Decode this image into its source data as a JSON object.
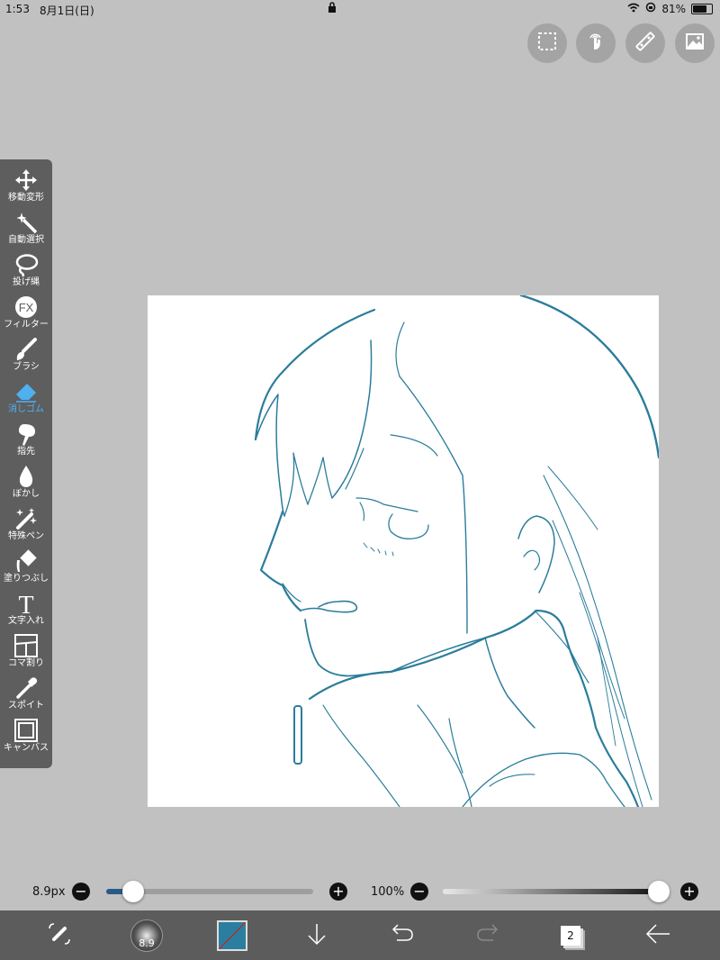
{
  "status_bar": {
    "time": "1:53",
    "date": "8月1日(日)",
    "battery": "81%",
    "battery_level": 0.81
  },
  "top_actions": {
    "icons": [
      "selection-icon",
      "touch-gesture-icon",
      "ruler-icon",
      "image-icon"
    ]
  },
  "toolbar": {
    "active_tool": "消しゴム",
    "tools": [
      {
        "label": "移動変形",
        "icon": "move-icon"
      },
      {
        "label": "自動選択",
        "icon": "magic-wand-icon"
      },
      {
        "label": "投げ縄",
        "icon": "lasso-icon"
      },
      {
        "label": "フィルター",
        "icon": "fx-icon"
      },
      {
        "label": "ブラシ",
        "icon": "brush-icon"
      },
      {
        "label": "消しゴム",
        "icon": "eraser-icon"
      },
      {
        "label": "指先",
        "icon": "smudge-icon"
      },
      {
        "label": "ぼかし",
        "icon": "blur-icon"
      },
      {
        "label": "特殊ペン",
        "icon": "special-pen-icon"
      },
      {
        "label": "塗りつぶし",
        "icon": "fill-icon"
      },
      {
        "label": "文字入れ",
        "icon": "text-icon"
      },
      {
        "label": "コマ割り",
        "icon": "panel-icon"
      },
      {
        "label": "スポイト",
        "icon": "eyedropper-icon"
      },
      {
        "label": "キャンバス",
        "icon": "canvas-icon"
      }
    ],
    "fx_glyph": "FX",
    "text_glyph": "T"
  },
  "brush_controls": {
    "size_label": "8.9px",
    "size_level": 0.14,
    "opacity_label": "100%",
    "opacity_level": 1.0
  },
  "bottom_bar": {
    "brush_size": "8.9",
    "layer_count": "2",
    "color": "#2a7fa0"
  },
  "colors": {
    "background": "#c1c1c1",
    "toolbar": "#5e5e5e",
    "active": "#4fb0f0",
    "line_art": "#2b7d9b",
    "slider_fill": "#2c5a86"
  }
}
